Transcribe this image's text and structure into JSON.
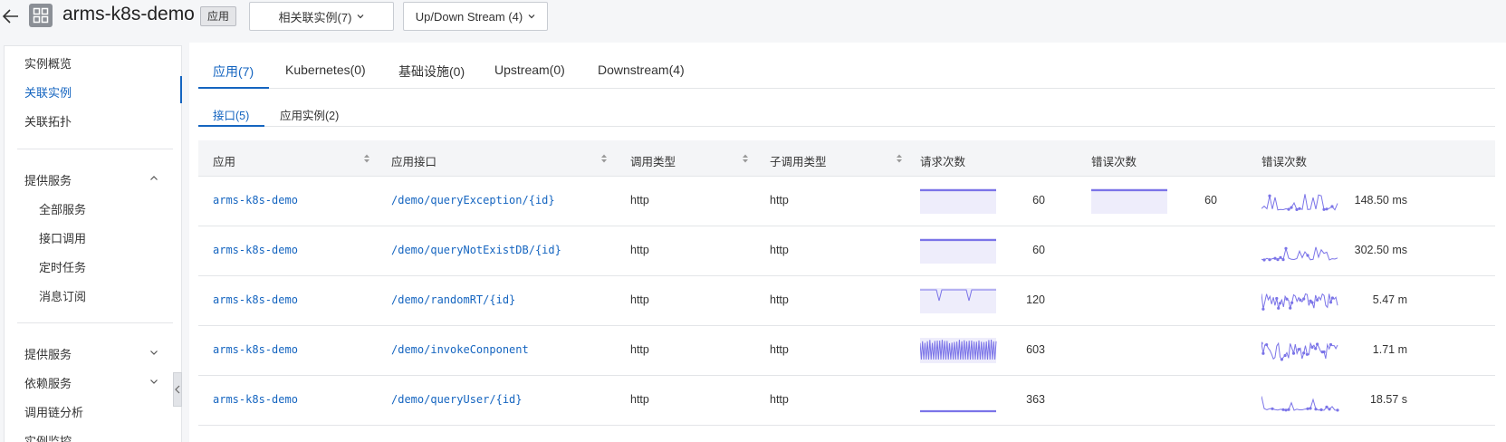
{
  "header": {
    "title": "arms-k8s-demo",
    "tag": "应用",
    "related_instances_label": "相关联实例(7)",
    "stream_label": "Up/Down Stream (4)"
  },
  "sidebar": {
    "items": [
      {
        "label": "实例概览"
      },
      {
        "label": "关联实例"
      },
      {
        "label": "关联拓扑"
      }
    ],
    "group1": {
      "label": "提供服务",
      "children": [
        {
          "label": "全部服务"
        },
        {
          "label": "接口调用"
        },
        {
          "label": "定时任务"
        },
        {
          "label": "消息订阅"
        }
      ]
    },
    "group2": {
      "label": "提供服务"
    },
    "group3": {
      "label": "依赖服务"
    },
    "trace": {
      "label": "调用链分析"
    },
    "monitor": {
      "label": "实例监控"
    }
  },
  "tabs": [
    {
      "label": "应用(7)"
    },
    {
      "label": "Kubernetes(0)"
    },
    {
      "label": "基础设施(0)"
    },
    {
      "label": "Upstream(0)"
    },
    {
      "label": "Downstream(4)"
    }
  ],
  "subtabs": [
    {
      "label": "接口(5)"
    },
    {
      "label": "应用实例(2)"
    }
  ],
  "table": {
    "headers": [
      "应用",
      "应用接口",
      "调用类型",
      "子调用类型",
      "请求次数",
      "错误次数",
      "错误次数"
    ],
    "rows": [
      {
        "app": "arms-k8s-demo",
        "api": "/demo/queryException/{id}",
        "call_type": "http",
        "sub_type": "http",
        "requests": "60",
        "errors": "60",
        "rt": "148.50 ms"
      },
      {
        "app": "arms-k8s-demo",
        "api": "/demo/queryNotExistDB/{id}",
        "call_type": "http",
        "sub_type": "http",
        "requests": "60",
        "errors": "",
        "rt": "302.50 ms"
      },
      {
        "app": "arms-k8s-demo",
        "api": "/demo/randomRT/{id}",
        "call_type": "http",
        "sub_type": "http",
        "requests": "120",
        "errors": "",
        "rt": "5.47 m"
      },
      {
        "app": "arms-k8s-demo",
        "api": "/demo/invokeConponent",
        "call_type": "http",
        "sub_type": "http",
        "requests": "603",
        "errors": "",
        "rt": "1.71 m"
      },
      {
        "app": "arms-k8s-demo",
        "api": "/demo/queryUser/{id}",
        "call_type": "http",
        "sub_type": "http",
        "requests": "363",
        "errors": "",
        "rt": "18.57 s"
      }
    ]
  },
  "colors": {
    "accent": "#1565c0",
    "sparkline": "#7b74e8",
    "sparkline_fill": "#eeedfb"
  }
}
